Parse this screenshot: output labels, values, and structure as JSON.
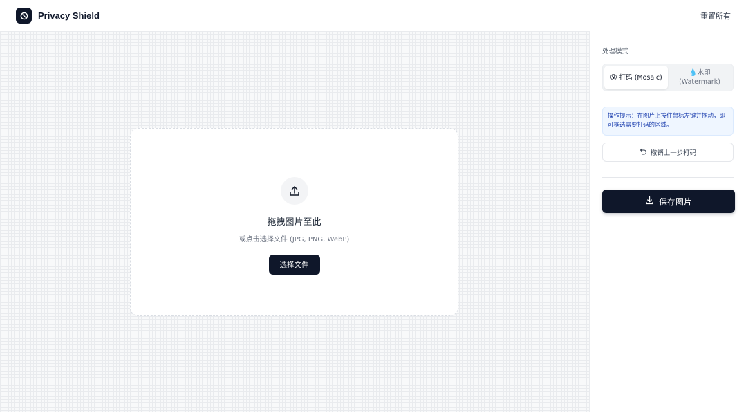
{
  "header": {
    "app_title": "Privacy Shield",
    "reset_label": "重置所有"
  },
  "dropzone": {
    "title": "拖拽图片至此",
    "subtitle": "或点击选择文件 (JPG, PNG, WebP)",
    "button_label": "选择文件"
  },
  "sidebar": {
    "mode_label": "处理模式",
    "modes": [
      {
        "emoji": "😵",
        "label": "打码 (Mosaic)",
        "active": true
      },
      {
        "emoji": "💧",
        "label_line1": "水印",
        "label_line2": "(Watermark)",
        "active": false
      }
    ],
    "tip": "操作提示：在图片上按住鼠标左键并拖动，即可框选需要打码的区域。",
    "undo_label": "撤销上一步打码",
    "save_label": "保存图片"
  },
  "colors": {
    "primary": "#0f172a",
    "tip_bg": "#eff6ff",
    "tip_text": "#1e40af"
  },
  "icons": [
    "shield-logo-icon",
    "upload-icon",
    "undo-icon",
    "download-icon"
  ]
}
